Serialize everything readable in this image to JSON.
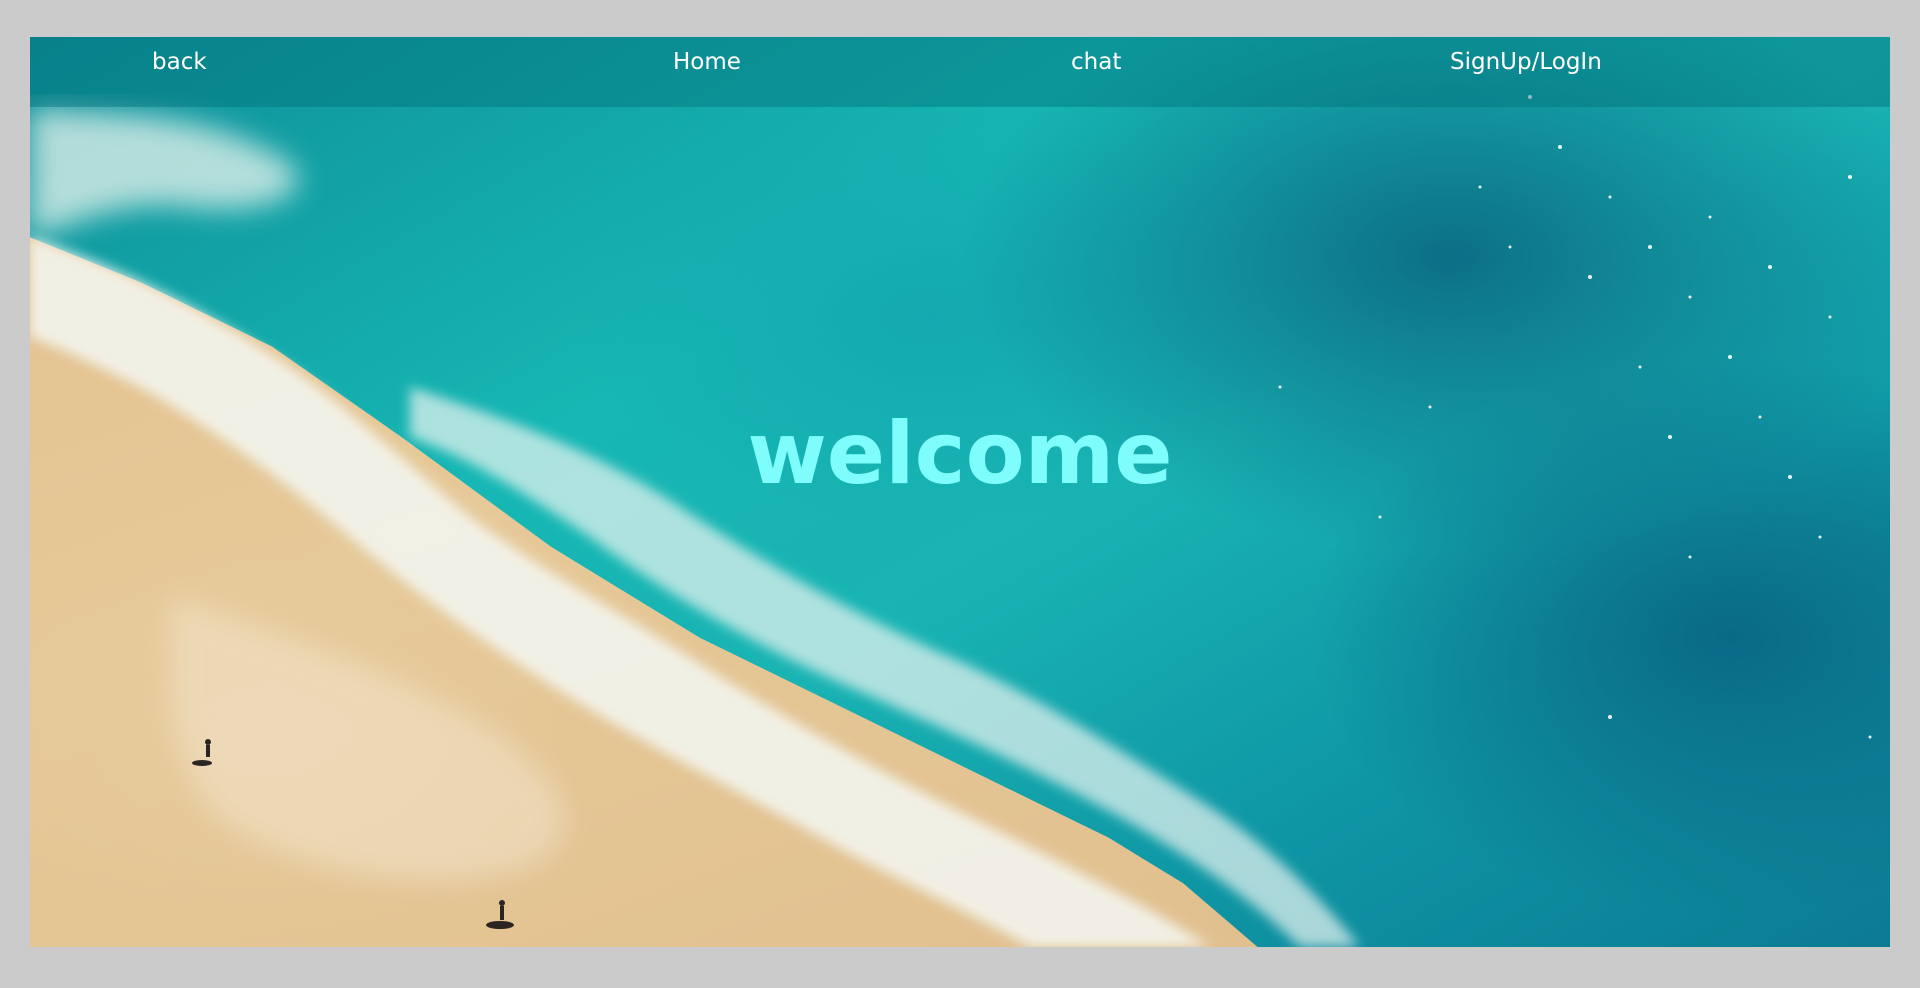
{
  "nav": {
    "back_label": "back",
    "home_label": "Home",
    "chat_label": "chat",
    "signup_label": "SignUp/LogIn"
  },
  "hero": {
    "headline": "welcome",
    "headline_color": "#7ffcfc"
  },
  "colors": {
    "page_background": "#cbcbcb",
    "navbar_overlay": "rgba(0,110,120,0.42)",
    "nav_text": "#ffffff"
  }
}
